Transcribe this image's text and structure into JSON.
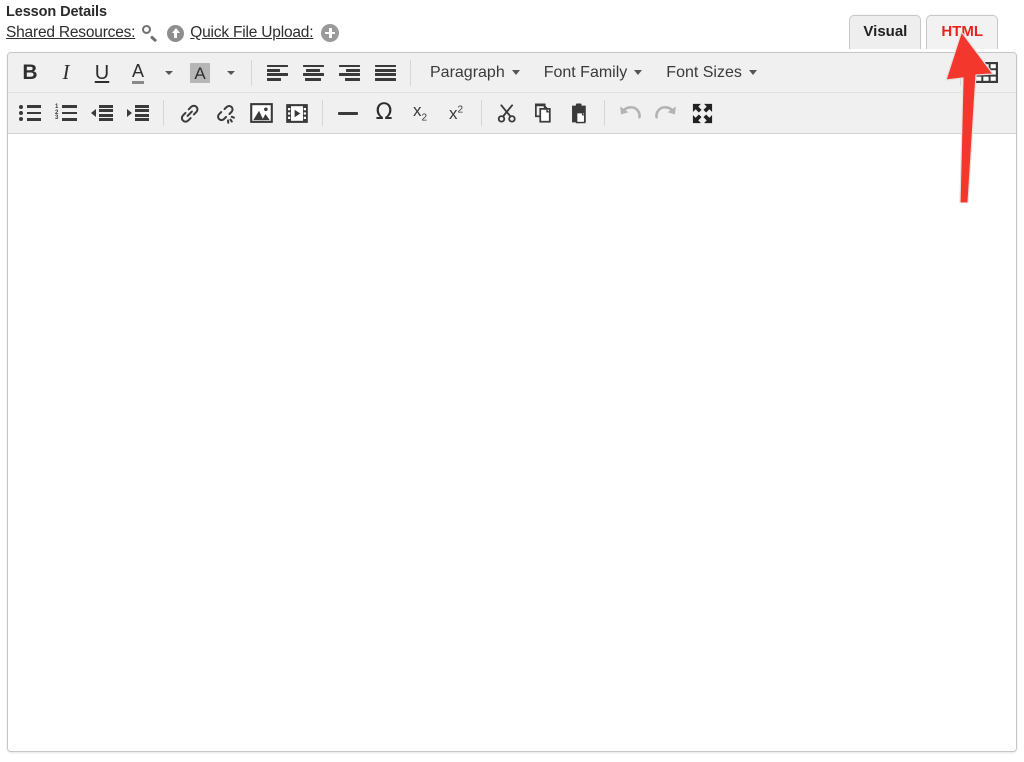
{
  "header": {
    "title": "Lesson Details",
    "shared_resources_label": "Shared Resources:",
    "quick_file_upload_label": "Quick File Upload:",
    "icons": {
      "search": "search-icon",
      "upload": "upload-circle-icon",
      "add": "plus-circle-icon"
    }
  },
  "tabs": [
    {
      "label": "Visual",
      "active": true,
      "color": "#222222"
    },
    {
      "label": "HTML",
      "active": false,
      "color": "#e8241f"
    }
  ],
  "annotation": {
    "type": "arrow",
    "color": "#f4372c",
    "points_to": "HTML"
  },
  "toolbar": {
    "row1": [
      {
        "name": "bold-button",
        "glyph": "B",
        "title": "Bold"
      },
      {
        "name": "italic-button",
        "glyph": "I",
        "title": "Italic"
      },
      {
        "name": "underline-button",
        "glyph": "U",
        "title": "Underline"
      },
      {
        "name": "text-color-button",
        "glyph": "A",
        "title": "Text color"
      },
      {
        "name": "text-color-dropdown",
        "glyph": "",
        "title": "Text color options"
      },
      {
        "name": "background-color-button",
        "glyph": "A",
        "title": "Background color"
      },
      {
        "name": "background-color-dropdown",
        "glyph": "",
        "title": "Background color options"
      },
      {
        "name": "align-left-button",
        "glyph": "",
        "title": "Align left"
      },
      {
        "name": "align-center-button",
        "glyph": "",
        "title": "Align center"
      },
      {
        "name": "align-right-button",
        "glyph": "",
        "title": "Align right"
      },
      {
        "name": "align-justify-button",
        "glyph": "",
        "title": "Justify"
      }
    ],
    "dropdowns": [
      {
        "name": "paragraph-dropdown",
        "label": "Paragraph"
      },
      {
        "name": "font-family-dropdown",
        "label": "Font Family"
      },
      {
        "name": "font-sizes-dropdown",
        "label": "Font Sizes"
      }
    ],
    "table_button": {
      "name": "table-button",
      "title": "Table"
    },
    "row2": [
      {
        "name": "bullet-list-button",
        "title": "Bulleted list"
      },
      {
        "name": "numbered-list-button",
        "title": "Numbered list"
      },
      {
        "name": "outdent-button",
        "title": "Decrease indent"
      },
      {
        "name": "indent-button",
        "title": "Increase indent"
      },
      {
        "name": "link-button",
        "title": "Insert link"
      },
      {
        "name": "unlink-button",
        "title": "Remove link"
      },
      {
        "name": "insert-image-button",
        "title": "Insert image"
      },
      {
        "name": "insert-media-button",
        "title": "Insert media"
      },
      {
        "name": "horizontal-rule-button",
        "title": "Horizontal rule"
      },
      {
        "name": "special-character-button",
        "glyph": "Ω",
        "title": "Special character"
      },
      {
        "name": "subscript-button",
        "glyph": "x",
        "sub": "2",
        "title": "Subscript"
      },
      {
        "name": "superscript-button",
        "glyph": "x",
        "sup": "2",
        "title": "Superscript"
      },
      {
        "name": "cut-button",
        "title": "Cut"
      },
      {
        "name": "copy-button",
        "title": "Copy"
      },
      {
        "name": "paste-button",
        "title": "Paste"
      },
      {
        "name": "undo-button",
        "title": "Undo",
        "disabled": true
      },
      {
        "name": "redo-button",
        "title": "Redo",
        "disabled": true
      },
      {
        "name": "fullscreen-button",
        "title": "Fullscreen"
      }
    ]
  },
  "editor_body": {
    "content": "",
    "placeholder": ""
  },
  "colors": {
    "toolbar_bg": "#f0f0f0",
    "page_bg": "#ffffff",
    "border": "#c6c6c6",
    "accent_red": "#e8241f",
    "arrow_red": "#f4372c",
    "icon_gray": "#3a3a3a"
  }
}
